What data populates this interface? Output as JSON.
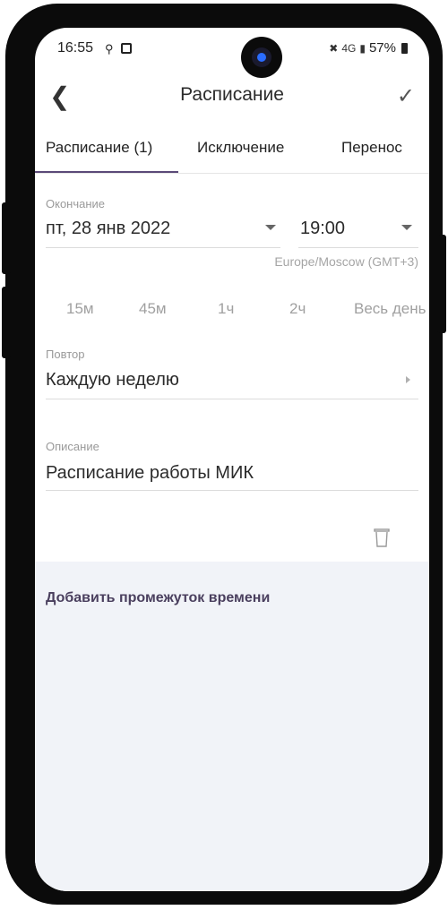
{
  "status_bar": {
    "time": "16:55",
    "network": "4G",
    "battery": "57%"
  },
  "header": {
    "title": "Расписание"
  },
  "tabs": [
    {
      "label": "Расписание (1)",
      "active": true
    },
    {
      "label": "Исключение",
      "active": false
    },
    {
      "label": "Перенос",
      "active": false
    }
  ],
  "end": {
    "label": "Окончание",
    "date": "пт, 28 янв 2022",
    "time": "19:00",
    "timezone": "Europe/Moscow (GMT+3)"
  },
  "duration_chips": [
    "15м",
    "45м",
    "1ч",
    "2ч",
    "Весь день"
  ],
  "repeat": {
    "label": "Повтор",
    "value": "Каждую неделю"
  },
  "description": {
    "label": "Описание",
    "value": "Расписание работы МИК"
  },
  "add_interval": "Добавить промежуток времени",
  "colors": {
    "accent": "#5b4a78",
    "bottom_area": "#f1f3f8"
  }
}
